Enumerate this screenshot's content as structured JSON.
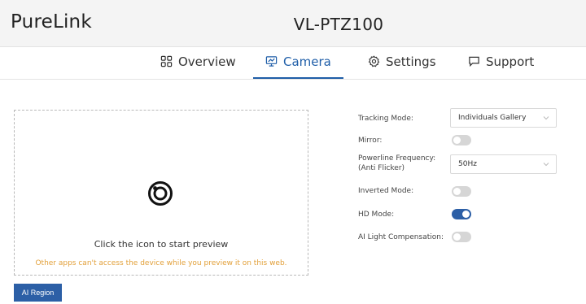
{
  "header": {
    "brand": "PureLink",
    "model": "VL-PTZ100"
  },
  "tabs": [
    {
      "label": "Overview",
      "icon": "grid-icon"
    },
    {
      "label": "Camera",
      "icon": "monitor-icon",
      "active": true
    },
    {
      "label": "Settings",
      "icon": "gear-icon"
    },
    {
      "label": "Support",
      "icon": "chat-icon"
    }
  ],
  "preview": {
    "title": "Click the icon to start preview",
    "warning": "Other apps can't access the device while you preview it on this web.",
    "icon": "camera-lens-icon"
  },
  "ai_region_label": "AI Region",
  "settings": {
    "tracking_mode": {
      "label": "Tracking Mode:",
      "value": "Individuals Gallery"
    },
    "mirror": {
      "label": "Mirror:",
      "on": false
    },
    "powerline": {
      "label_line1": "Powerline Frequency:",
      "label_line2": "(Anti Flicker)",
      "value": "50Hz"
    },
    "inverted": {
      "label": "Inverted Mode:",
      "on": false
    },
    "hd": {
      "label": "HD Mode:",
      "on": true
    },
    "ai_light": {
      "label": "AI Light Compensation:",
      "on": false
    }
  },
  "colors": {
    "accent": "#2c5fa6",
    "active_tab": "#1f5ea8",
    "warning": "#e2a03a"
  }
}
